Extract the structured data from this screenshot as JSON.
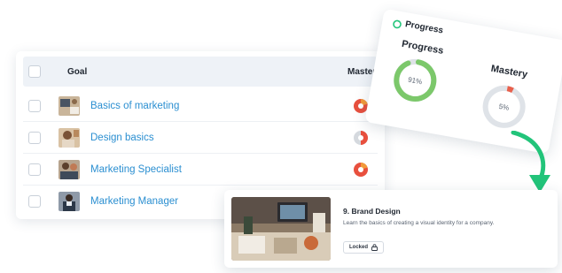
{
  "goals_table": {
    "header": {
      "goal": "Goal",
      "mastery": "Mastery"
    },
    "rows": [
      {
        "label": "Basics of marketing",
        "mastery_icon": "red-orange-pie-icon"
      },
      {
        "label": "Design basics",
        "mastery_icon": "grey-red-pie-icon"
      },
      {
        "label": "Marketing Specialist",
        "mastery_icon": "red-orange-pie-icon"
      },
      {
        "label": "Marketing Manager",
        "mastery_icon": "red-orange-pie-icon"
      }
    ]
  },
  "progress_card": {
    "title": "Progress",
    "progress": {
      "label": "Progress",
      "value_text": "91%",
      "value": 0.91,
      "color": "#7cc86b"
    },
    "mastery": {
      "label": "Mastery",
      "value_text": "5%",
      "value": 0.05,
      "color": "#e8604c"
    }
  },
  "course_card": {
    "title": "9. Brand Design",
    "description": "Learn the basics of creating a visual identity for a company.",
    "status": "Locked"
  },
  "colors": {
    "link": "#2b8fd1",
    "accent_green": "#22c47a",
    "ring_track": "#dfe3e8",
    "pie_red": "#e8503e",
    "pie_orange": "#f29a3a"
  }
}
